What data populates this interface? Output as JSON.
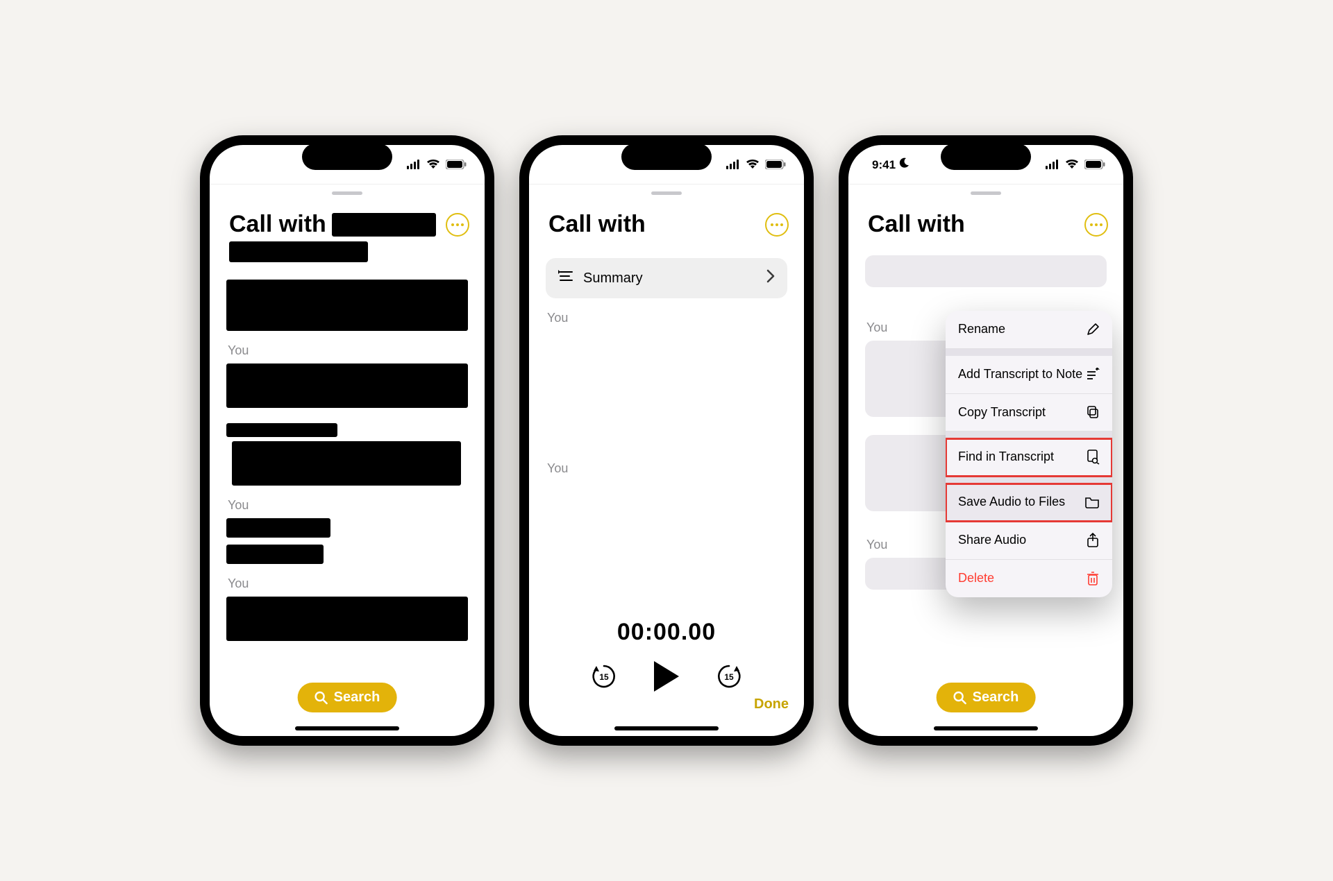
{
  "status": {
    "time": "9:41"
  },
  "phone1": {
    "title_prefix": "Call with",
    "speakers": [
      "You",
      "You",
      "You"
    ],
    "search_label": "Search"
  },
  "phone2": {
    "title": "Call with",
    "summary_label": "Summary",
    "speakers": [
      "You",
      "You"
    ],
    "timecode": "00:00.00",
    "skip_seconds": "15",
    "done_label": "Done"
  },
  "phone3": {
    "title": "Call with",
    "speakers": [
      "You",
      "You"
    ],
    "menu": {
      "rename": "Rename",
      "add_transcript": "Add Transcript to Note",
      "copy_transcript": "Copy Transcript",
      "find_transcript": "Find in Transcript",
      "save_audio": "Save Audio to Files",
      "share_audio": "Share Audio",
      "delete": "Delete"
    },
    "search_label": "Search"
  }
}
